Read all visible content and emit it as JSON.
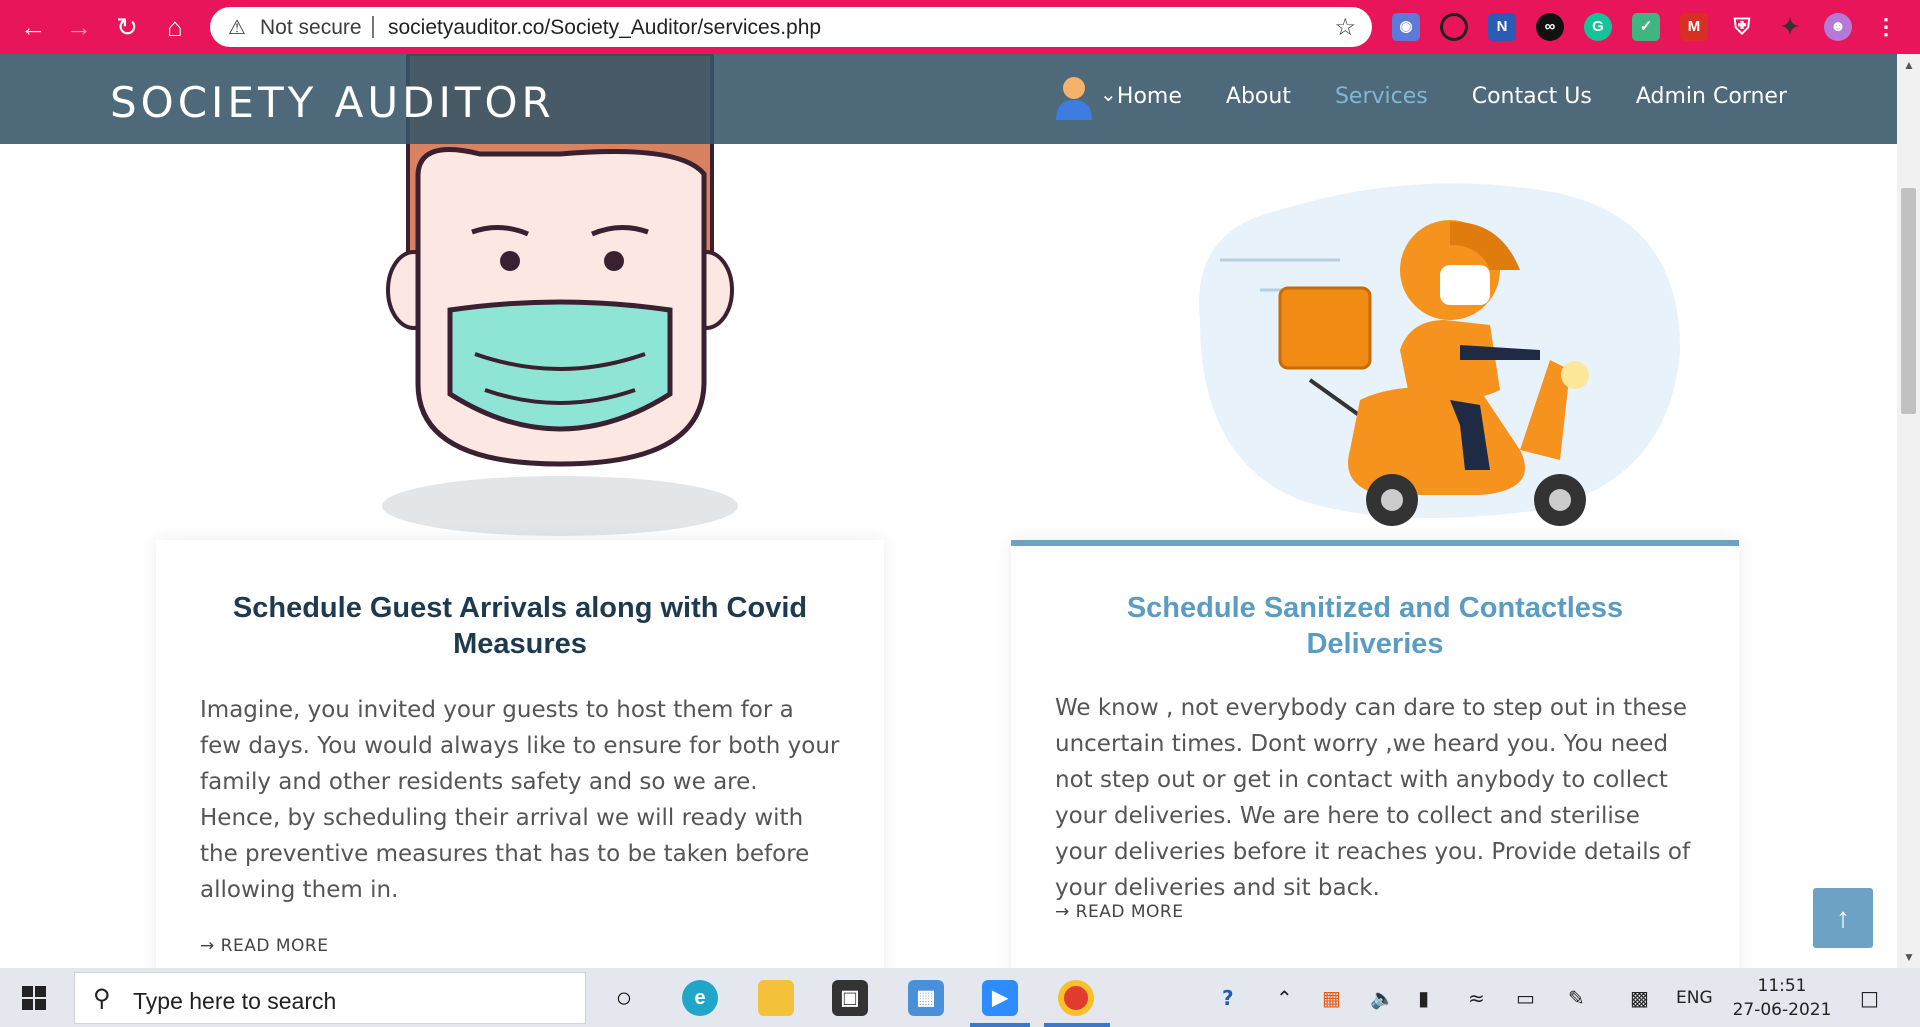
{
  "browser": {
    "security_label": "Not secure",
    "url": "societyauditor.co/Society_Auditor/services.php"
  },
  "site": {
    "brand": "SOCIETY AUDITOR",
    "nav": [
      {
        "label": "Home"
      },
      {
        "label": "About"
      },
      {
        "label": "Services",
        "active": true
      },
      {
        "label": "Contact Us"
      },
      {
        "label": "Admin Corner"
      }
    ]
  },
  "cards": [
    {
      "title": "Schedule Guest Arrivals along with Covid Measures",
      "body": "Imagine, you invited your guests to host them for a few days. You would always like to ensure for both your family and other residents safety and so we are. Hence, by scheduling their arrival we will ready with the preventive measures that has to be taken before allowing them in.",
      "read_more": "READ MORE"
    },
    {
      "title": "Schedule Sanitized and Contactless Deliveries",
      "body": "We know , not everybody can dare to step out in these uncertain times. Dont worry ,we heard you. You need not step out or get in contact with anybody to collect your deliveries. We are here to collect and sterilise your deliveries before it reaches you. Provide details of your deliveries and sit back.",
      "read_more": "READ MORE"
    }
  ],
  "taskbar": {
    "search_placeholder": "Type here to search",
    "language": "ENG",
    "time": "11:51",
    "date": "27-06-2021"
  },
  "colors": {
    "chrome": "#e8155b",
    "nav": "#345468",
    "accent": "#6ea2c4",
    "title_dark": "#1e3a4f"
  }
}
